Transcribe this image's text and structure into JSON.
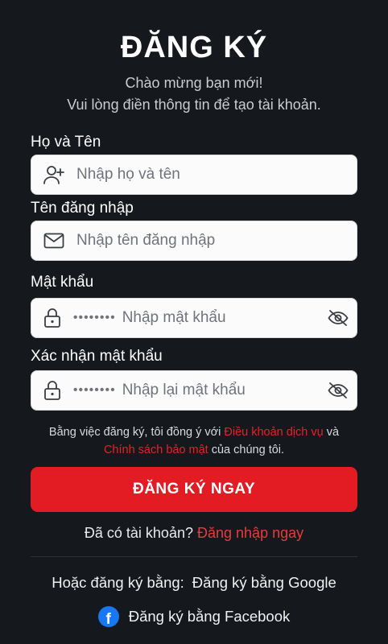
{
  "header": {
    "title": "ĐĂNG KÝ",
    "subtitle_line1": "Chào mừng bạn mới!",
    "subtitle_line2": "Vui lòng điền thông tin để tạo tài khoản."
  },
  "form": {
    "fullname": {
      "label": "Họ và Tên",
      "placeholder": "Nhập họ và tên",
      "icon": "user-add-icon"
    },
    "username": {
      "label": "Tên đăng nhập",
      "placeholder": "Nhập tên đăng nhập",
      "icon": "envelope-icon"
    },
    "password": {
      "label": "Mật khẩu",
      "masked": "••••••••",
      "placeholder": "Nhập mật khẩu",
      "icon": "lock-icon",
      "toggle_icon": "eye-off-icon"
    },
    "confirm_password": {
      "label": "Xác nhận mật khẩu",
      "masked": "••••••••",
      "placeholder": "Nhập lại mật khẩu",
      "icon": "lock-icon",
      "toggle_icon": "eye-off-icon"
    }
  },
  "terms": {
    "prefix": "Bằng việc đăng ký, tôi đồng ý với ",
    "terms_link": "Điều khoản dịch vụ",
    "middle": " và ",
    "privacy_link": "Chính sách bảo mật",
    "suffix": " của chúng tôi."
  },
  "submit_label": "ĐĂNG KÝ NGAY",
  "login": {
    "prompt": "Đã có tài khoản?",
    "link": "Đăng nhập ngay"
  },
  "social": {
    "prefix": "Hoặc đăng ký bằng:",
    "google": "Đăng ký bằng Google",
    "facebook": "Đăng ký bằng Facebook",
    "facebook_icon": "facebook-icon"
  },
  "colors": {
    "background": "#15181c",
    "accent": "#e31b23",
    "link": "#e5222a",
    "facebook": "#1877f2"
  }
}
